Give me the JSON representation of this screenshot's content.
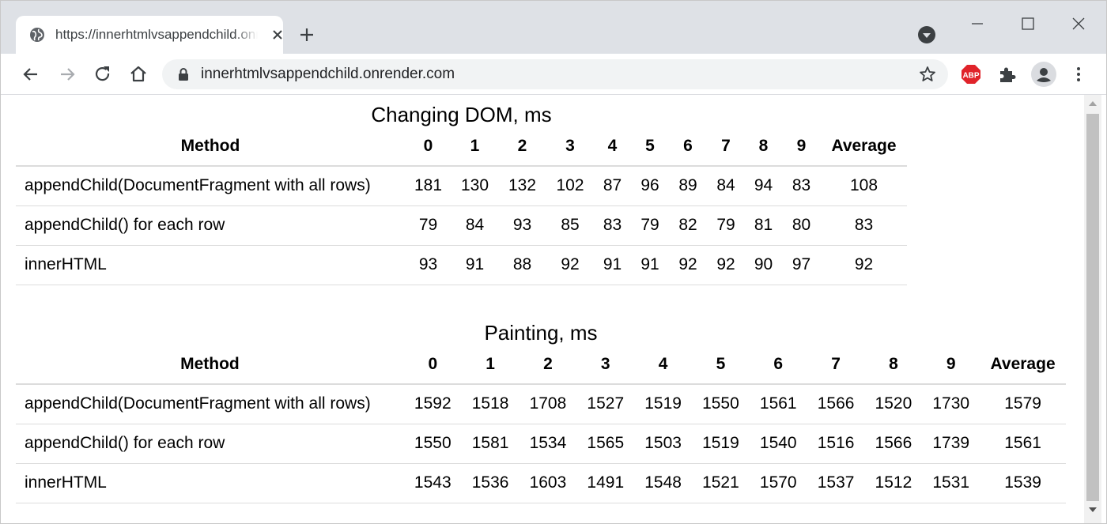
{
  "browser": {
    "tab_title": "https://innerhtmlvsappendchild.onrender.com",
    "url": "innerhtmlvsappendchild.onrender.com",
    "abp_label": "ABP"
  },
  "colors": {
    "abp_red": "#e0232a",
    "tabstrip": "#dee1e6",
    "omnibox": "#f1f3f4"
  },
  "table_dom": {
    "caption": "Changing DOM, ms",
    "headers": [
      "Method",
      "0",
      "1",
      "2",
      "3",
      "4",
      "5",
      "6",
      "7",
      "8",
      "9",
      "Average"
    ],
    "rows": [
      [
        "appendChild(DocumentFragment with all rows)",
        "181",
        "130",
        "132",
        "102",
        "87",
        "96",
        "89",
        "84",
        "94",
        "83",
        "108"
      ],
      [
        "appendChild() for each row",
        "79",
        "84",
        "93",
        "85",
        "83",
        "79",
        "82",
        "79",
        "81",
        "80",
        "83"
      ],
      [
        "innerHTML",
        "93",
        "91",
        "88",
        "92",
        "91",
        "91",
        "92",
        "92",
        "90",
        "97",
        "92"
      ]
    ]
  },
  "table_paint": {
    "caption": "Painting, ms",
    "headers": [
      "Method",
      "0",
      "1",
      "2",
      "3",
      "4",
      "5",
      "6",
      "7",
      "8",
      "9",
      "Average"
    ],
    "rows": [
      [
        "appendChild(DocumentFragment with all rows)",
        "1592",
        "1518",
        "1708",
        "1527",
        "1519",
        "1550",
        "1561",
        "1566",
        "1520",
        "1730",
        "1579"
      ],
      [
        "appendChild() for each row",
        "1550",
        "1581",
        "1534",
        "1565",
        "1503",
        "1519",
        "1540",
        "1516",
        "1566",
        "1739",
        "1561"
      ],
      [
        "innerHTML",
        "1543",
        "1536",
        "1603",
        "1491",
        "1548",
        "1521",
        "1570",
        "1537",
        "1512",
        "1531",
        "1539"
      ]
    ]
  }
}
